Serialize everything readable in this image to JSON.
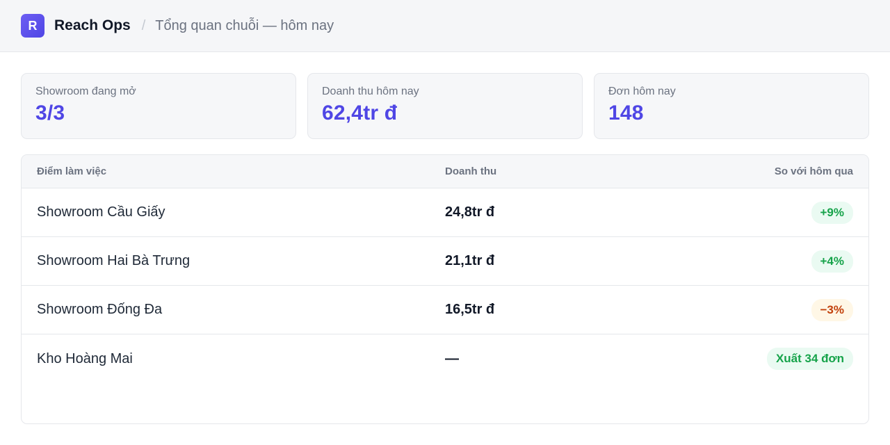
{
  "header": {
    "logo_letter": "R",
    "app_name": "Reach Ops",
    "separator": "/",
    "breadcrumb": "Tổng quan chuỗi — hôm nay"
  },
  "stats": [
    {
      "label": "Showroom đang mở",
      "value": "3/3"
    },
    {
      "label": "Doanh thu hôm nay",
      "value": "62,4tr đ"
    },
    {
      "label": "Đơn hôm nay",
      "value": "148"
    }
  ],
  "table": {
    "columns": [
      "Điểm làm việc",
      "Doanh thu",
      "So với hôm qua"
    ],
    "rows": [
      {
        "location": "Showroom Cầu Giấy",
        "revenue": "24,8tr đ",
        "change": "+9%",
        "trend": "up"
      },
      {
        "location": "Showroom Hai Bà Trưng",
        "revenue": "21,1tr đ",
        "change": "+4%",
        "trend": "up"
      },
      {
        "location": "Showroom Đống Đa",
        "revenue": "16,5tr đ",
        "change": "−3%",
        "trend": "down"
      },
      {
        "location": "Kho Hoàng Mai",
        "revenue": "—",
        "change": "Xuất 34 đơn",
        "trend": "up"
      }
    ]
  },
  "colors": {
    "accent": "#4f46e5",
    "positive": "#16a34a",
    "negative": "#c2410c"
  }
}
